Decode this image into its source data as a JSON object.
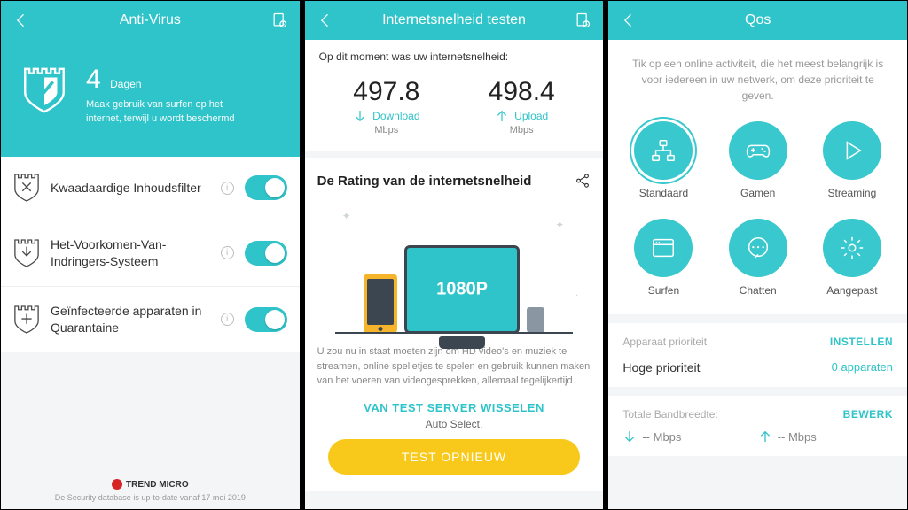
{
  "panel1": {
    "title": "Anti-Virus",
    "days_value": "4",
    "days_label": "Dagen",
    "hero_sub": "Maak gebruik van surfen op het internet, terwijl u wordt beschermd",
    "rows": [
      {
        "label": "Kwaadaardige Inhoudsfilter"
      },
      {
        "label": "Het-Voorkomen-Van-Indringers-Systeem"
      },
      {
        "label": "Geïnfecteerde apparaten in Quarantaine"
      }
    ],
    "brand": "TREND MICRO",
    "footer": "De Security database is up-to-date vanaf 17 mei 2019"
  },
  "panel2": {
    "title": "Internetsnelheid testen",
    "caption": "Op dit moment was uw internetsnelheid:",
    "download_value": "497.8",
    "download_label": "Download",
    "download_unit": "Mbps",
    "upload_value": "498.4",
    "upload_label": "Upload",
    "upload_unit": "Mbps",
    "rating_title": "De Rating van de internetsnelheid",
    "resolution": "1080P",
    "description": "U zou nu in staat moeten zijn om HD video's en muziek te streamen, online spelletjes te spelen en gebruik kunnen maken van het voeren van videogesprekken, allemaal tegelijkertijd.",
    "server_link": "VAN TEST SERVER WISSELEN",
    "auto_select": "Auto Select.",
    "retest": "TEST OPNIEUW"
  },
  "panel3": {
    "title": "Qos",
    "caption": "Tik op een online activiteit, die het meest belangrijk is voor iedereen in uw netwerk, om deze prioriteit te geven.",
    "tiles": [
      {
        "label": "Standaard"
      },
      {
        "label": "Gamen"
      },
      {
        "label": "Streaming"
      },
      {
        "label": "Surfen"
      },
      {
        "label": "Chatten"
      },
      {
        "label": "Aangepast"
      }
    ],
    "device_priority_label": "Apparaat prioriteit",
    "device_priority_action": "INSTELLEN",
    "high_priority_label": "Hoge prioriteit",
    "high_priority_value": "0 apparaten",
    "bandwidth_label": "Totale Bandbreedte:",
    "bandwidth_action": "BEWERK",
    "bw_down": "-- Mbps",
    "bw_up": "-- Mbps"
  }
}
